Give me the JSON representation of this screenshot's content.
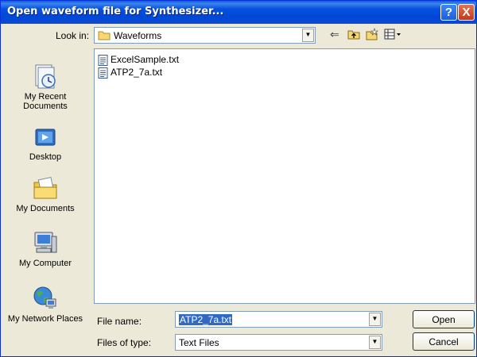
{
  "dialog": {
    "title": "Open waveform file for Synthesizer...",
    "help_glyph": "?",
    "close_glyph": "X"
  },
  "lookin": {
    "label": "Look in:",
    "value": "Waveforms"
  },
  "places": [
    {
      "label": "My Recent Documents",
      "icon": "recent-documents-icon"
    },
    {
      "label": "Desktop",
      "icon": "desktop-icon"
    },
    {
      "label": "My Documents",
      "icon": "my-documents-icon"
    },
    {
      "label": "My Computer",
      "icon": "my-computer-icon"
    },
    {
      "label": "My Network Places",
      "icon": "network-places-icon"
    }
  ],
  "files": [
    {
      "name": "ExcelSample.txt",
      "icon": "text-file-icon"
    },
    {
      "name": "ATP2_7a.txt",
      "icon": "text-file-icon"
    }
  ],
  "filename": {
    "label": "File name:",
    "value": "ATP2_7a.txt"
  },
  "filetype": {
    "label": "Files of type:",
    "value": "Text Files"
  },
  "buttons": {
    "open": "Open",
    "cancel": "Cancel"
  },
  "colors": {
    "titlebar": "#0054e3",
    "dialog_bg": "#ece9d8",
    "selection": "#316ac5"
  }
}
